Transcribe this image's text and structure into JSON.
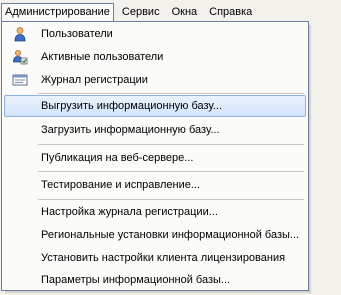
{
  "menubar": {
    "items": [
      {
        "label": "Администрирование"
      },
      {
        "label": "Сервис"
      },
      {
        "label": "Окна"
      },
      {
        "label": "Справка"
      }
    ]
  },
  "dropdown": {
    "items": [
      {
        "label": "Пользователи",
        "icon": "user-icon"
      },
      {
        "label": "Активные пользователи",
        "icon": "active-users-icon"
      },
      {
        "label": "Журнал регистрации",
        "icon": "log-journal-icon"
      },
      {
        "label": "Выгрузить информационную базу..."
      },
      {
        "label": "Загрузить информационную базу..."
      },
      {
        "label": "Публикация на веб-сервере..."
      },
      {
        "label": "Тестирование и исправление..."
      },
      {
        "label": "Настройка журнала регистрации..."
      },
      {
        "label": "Региональные установки информационной базы..."
      },
      {
        "label": "Установить настройки клиента лицензирования"
      },
      {
        "label": "Параметры информационной базы..."
      }
    ]
  }
}
